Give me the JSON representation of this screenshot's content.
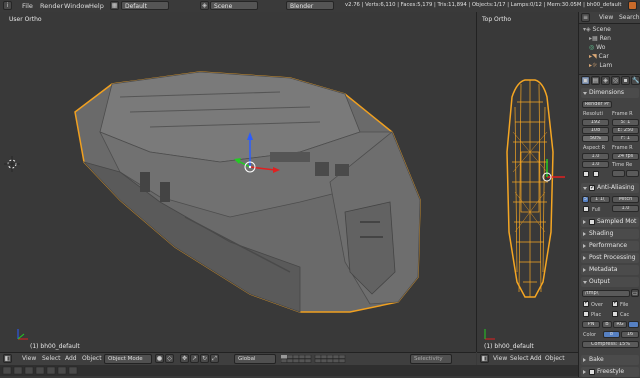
{
  "topbar": {
    "menus": [
      "File",
      "Render",
      "Window",
      "Help"
    ],
    "layout": "Default",
    "scene": "Scene",
    "engine": "Blender Render",
    "stats": "v2.76 | Verts:6,110 | Faces:5,179 | Tris:11,894 | Objects:1/17 | Lamps:0/12 | Mem:30.05M | bh00_default"
  },
  "viewport_left": {
    "label": "User Ortho",
    "object_label": "(1) bh00_default"
  },
  "viewport_right": {
    "label": "Top Ortho",
    "object_label": "(1) bh00_default"
  },
  "header_left": {
    "items": [
      "View",
      "Select",
      "Add",
      "Object"
    ],
    "mode": "Object Mode",
    "orientation": "Global",
    "selectivity": "Selectivity"
  },
  "header_right": {
    "items": [
      "View",
      "Select",
      "Add",
      "Object"
    ]
  },
  "outliner": {
    "menus": [
      "View",
      "Search"
    ],
    "items": [
      "Scene",
      "Ren",
      "Wo",
      "Car",
      "Lam"
    ]
  },
  "properties": {
    "dimensions": {
      "title": "Dimensions",
      "preset": "Render Pr",
      "resolution_label": "Resoluti",
      "frame_range_label": "Frame R",
      "res_x": "192",
      "res_y": "108",
      "res_pct": "50%",
      "frame_start": "S: 1",
      "frame_end": "E: 250",
      "frame_step": "F: 1",
      "aspect_label": "Aspect R",
      "frame_rate_label": "Frame R",
      "aspect_x": "1.0",
      "aspect_y": "1.0",
      "fps": "24 fps",
      "time_re_label": "Time Re"
    },
    "anti_aliasing": {
      "title": "Anti-Aliasing",
      "samples": "5",
      "samples2": "1 1(",
      "filter": "Mitch",
      "full_label": "Full",
      "full_value": "1.0"
    },
    "panels_closed": [
      "Sampled Mot",
      "Shading",
      "Performance",
      "Post Processing",
      "Metadata"
    ],
    "output": {
      "title": "Output",
      "path": "/tmp\\",
      "overwrite": "Over",
      "file_ext": "File",
      "placeholders": "Plac",
      "cache": "Cac",
      "format": "PN",
      "bw": "B",
      "rgb": "RG",
      "color_label": "Color",
      "color_depth_a": "8",
      "color_depth_b": "16",
      "compression": "Compress: 15%"
    },
    "bottom_panels": [
      "Bake",
      "Freestyle"
    ]
  },
  "colors": {
    "background": "#393939",
    "wireframe": "#f5a623",
    "selected_outline": "#f0a020",
    "panel": "#434343"
  }
}
